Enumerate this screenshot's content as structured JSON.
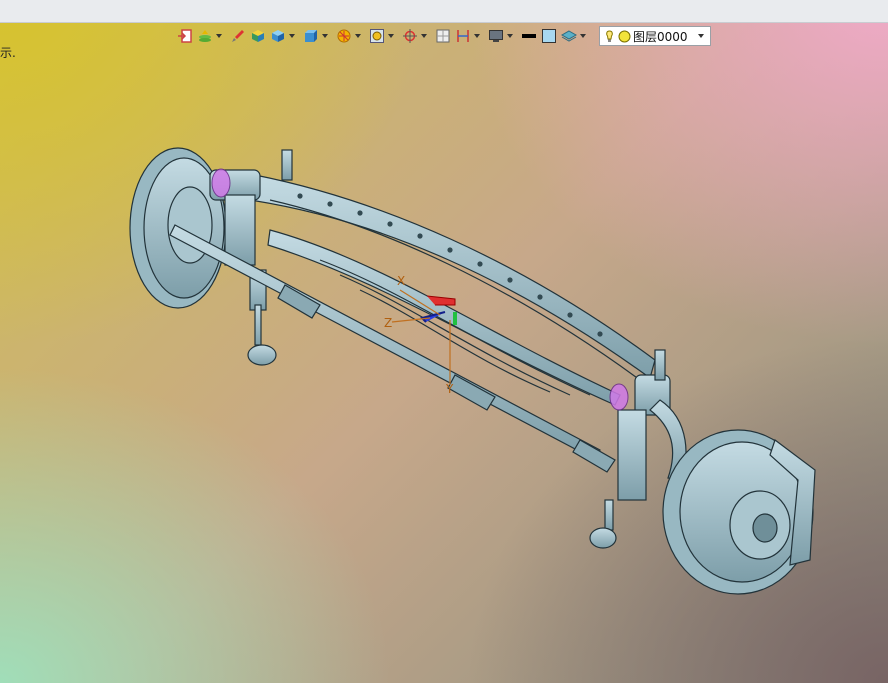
{
  "viewport": {
    "left_text": "示.",
    "background_colors": [
      "#d4c43a",
      "#f2a9c9",
      "#9fdcb6",
      "#7d6a69"
    ],
    "model_color": "#9fbcc6",
    "axis_labels": {
      "x": "X",
      "z": "Z",
      "y": "Y"
    }
  },
  "toolbar": {
    "buttons": [
      {
        "icon": "exit-sketch-icon",
        "has_dropdown": false
      },
      {
        "icon": "layer-stack-icon",
        "has_dropdown": true
      },
      {
        "icon": "brush-icon",
        "has_dropdown": false
      },
      {
        "icon": "yellow-cube-icon",
        "has_dropdown": false
      },
      {
        "icon": "blue-cube-icon",
        "has_dropdown": true
      },
      {
        "icon": "view-cube-icon",
        "has_dropdown": true
      },
      {
        "icon": "section-view-icon",
        "has_dropdown": true
      },
      {
        "icon": "shaded-display-icon",
        "has_dropdown": true
      },
      {
        "icon": "crosshair-icon",
        "has_dropdown": true
      },
      {
        "icon": "grid-icon",
        "has_dropdown": false
      },
      {
        "icon": "dimension-icon",
        "has_dropdown": true
      },
      {
        "icon": "monitor-icon",
        "has_dropdown": true
      },
      {
        "icon": "line-weight-icon",
        "has_dropdown": false
      },
      {
        "icon": "color-swatch-icon",
        "has_dropdown": false
      },
      {
        "icon": "layers-icon",
        "has_dropdown": true
      }
    ],
    "layer_select": {
      "value": "图层0000",
      "bulb_icon": "bulb-icon",
      "sun_icon": "sun-icon"
    }
  }
}
